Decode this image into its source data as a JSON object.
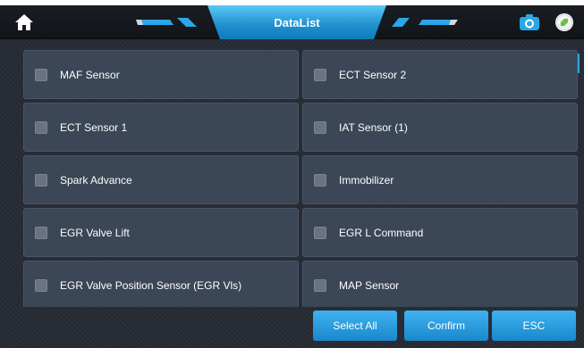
{
  "header": {
    "title": "DataList",
    "home_icon": "home-icon",
    "camera_icon": "camera-icon",
    "link_icon": "link-icon",
    "accent_color": "#1e8fd0"
  },
  "items": [
    {
      "label": "MAF Sensor",
      "checked": false
    },
    {
      "label": "ECT Sensor 2",
      "checked": false
    },
    {
      "label": "ECT Sensor 1",
      "checked": false
    },
    {
      "label": "IAT Sensor (1)",
      "checked": false
    },
    {
      "label": "Spark Advance",
      "checked": false
    },
    {
      "label": "Immobilizer",
      "checked": false
    },
    {
      "label": "EGR Valve Lift",
      "checked": false
    },
    {
      "label": "EGR L Command",
      "checked": false
    },
    {
      "label": "EGR Valve Position Sensor (EGR Vls)",
      "checked": false
    },
    {
      "label": "MAP Sensor",
      "checked": false
    }
  ],
  "footer": {
    "select_all_label": "Select All",
    "confirm_label": "Confirm",
    "esc_label": "ESC"
  }
}
